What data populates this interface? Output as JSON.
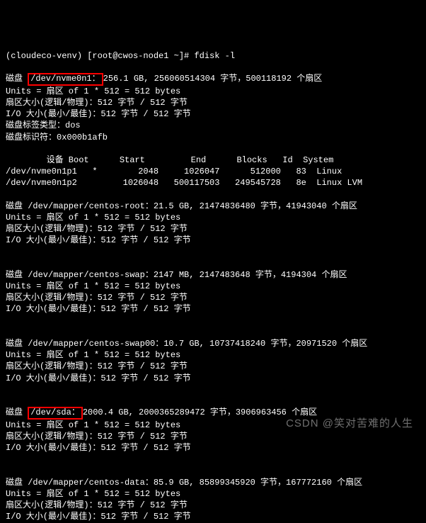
{
  "prompt": "(cloudeco-venv) [root@cwos-node1 ~]# fdisk -l",
  "disk1": {
    "dev_hl": "/dev/nvme0n1：",
    "tail": "256.1 GB, 256060514304 字节，500118192 个扇区",
    "units": "Units = 扇区 of 1 * 512 = 512 bytes",
    "sector": "扇区大小(逻辑/物理)：512 字节 / 512 字节",
    "io": "I/O 大小(最小/最佳)：512 字节 / 512 字节",
    "labeltype": "磁盘标签类型：dos",
    "ident": "磁盘标识符：0x000b1afb"
  },
  "ptable": {
    "hdr": "        设备 Boot      Start         End      Blocks   Id  System",
    "r1": "/dev/nvme0n1p1   *        2048     1026047      512000   83  Linux",
    "r2": "/dev/nvme0n1p2         1026048   500117503   249545728   8e  Linux LVM"
  },
  "disk2": {
    "head": "磁盘 /dev/mapper/centos-root：21.5 GB, 21474836480 字节，41943040 个扇区",
    "units": "Units = 扇区 of 1 * 512 = 512 bytes",
    "sector": "扇区大小(逻辑/物理)：512 字节 / 512 字节",
    "io": "I/O 大小(最小/最佳)：512 字节 / 512 字节"
  },
  "disk3": {
    "head": "磁盘 /dev/mapper/centos-swap：2147 MB, 2147483648 字节，4194304 个扇区",
    "units": "Units = 扇区 of 1 * 512 = 512 bytes",
    "sector": "扇区大小(逻辑/物理)：512 字节 / 512 字节",
    "io": "I/O 大小(最小/最佳)：512 字节 / 512 字节"
  },
  "disk4": {
    "head": "磁盘 /dev/mapper/centos-swap00：10.7 GB, 10737418240 字节，20971520 个扇区",
    "units": "Units = 扇区 of 1 * 512 = 512 bytes",
    "sector": "扇区大小(逻辑/物理)：512 字节 / 512 字节",
    "io": "I/O 大小(最小/最佳)：512 字节 / 512 字节"
  },
  "disk5": {
    "lead": "磁盘 ",
    "dev_hl": "/dev/sda：",
    "tail": "2000.4 GB, 2000365289472 字节，3906963456 个扇区",
    "units": "Units = 扇区 of 1 * 512 = 512 bytes",
    "sector": "扇区大小(逻辑/物理)：512 字节 / 512 字节",
    "io": "I/O 大小(最小/最佳)：512 字节 / 512 字节"
  },
  "disk6": {
    "head": "磁盘 /dev/mapper/centos-data：85.9 GB, 85899345920 字节，167772160 个扇区",
    "units": "Units = 扇区 of 1 * 512 = 512 bytes",
    "sector": "扇区大小(逻辑/物理)：512 字节 / 512 字节",
    "io": "I/O 大小(最小/最佳)：512 字节 / 512 字节"
  },
  "watermark": "CSDN @笑对苦难的人生"
}
